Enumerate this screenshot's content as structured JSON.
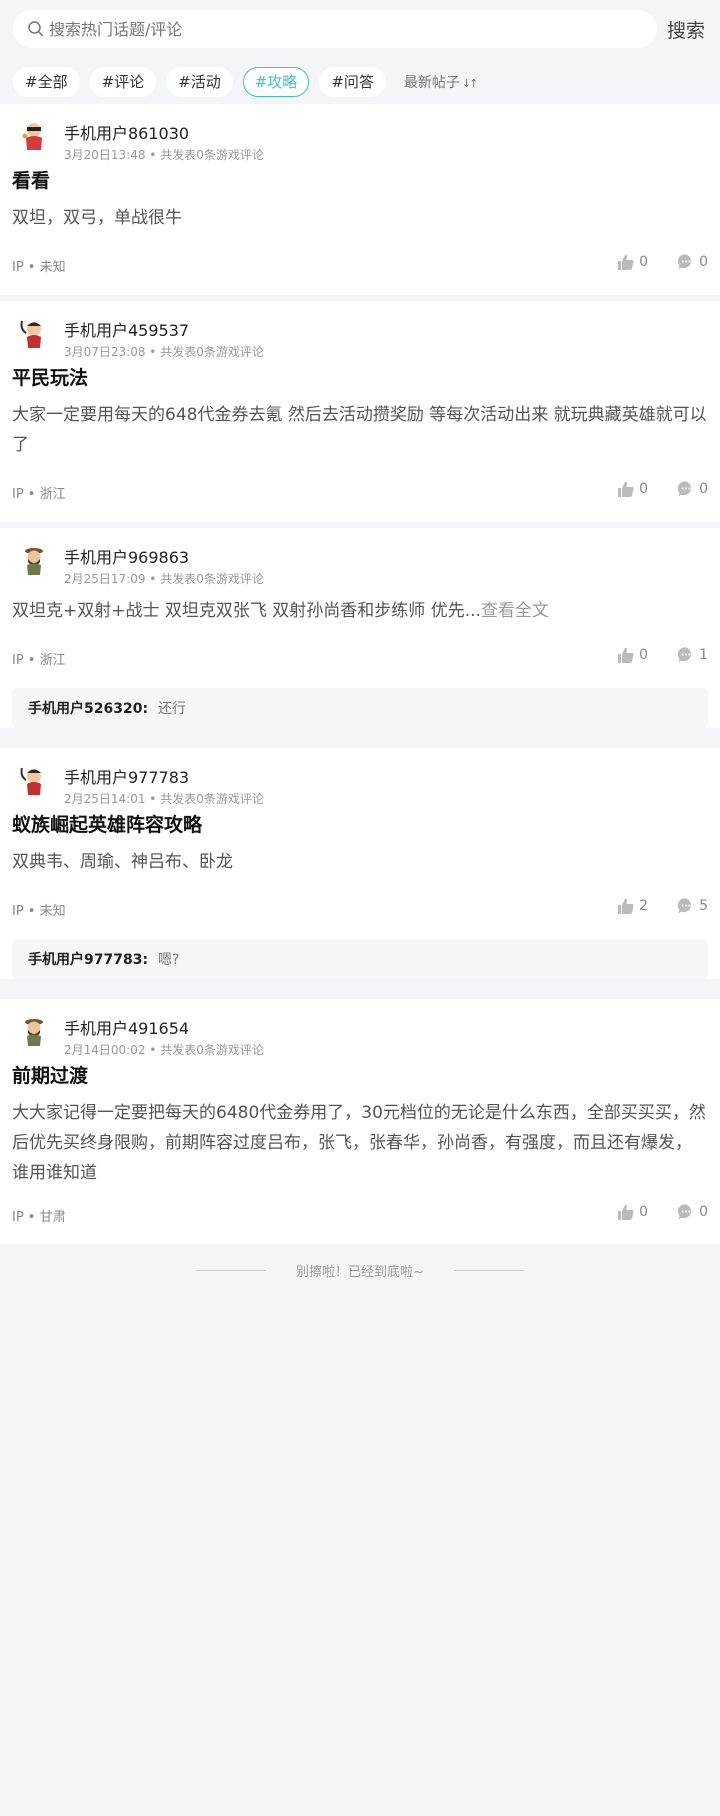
{
  "search": {
    "placeholder": "搜索热门话题/评论",
    "button": "搜索"
  },
  "tags": [
    "#全部",
    "#评论",
    "#活动",
    "#攻略",
    "#问答"
  ],
  "active_tag": "#攻略",
  "sort": {
    "label": "最新帖子",
    "icon": "sort-arrows-icon"
  },
  "posts": [
    {
      "user": "手机用户861030",
      "meta": "3月20日13:48 • 共发表0条游戏评论",
      "title": "看看",
      "content": "双坦，双弓，单战很牛",
      "ip": "IP • 未知",
      "likes": "0",
      "comments": "0"
    },
    {
      "user": "手机用户459537",
      "meta": "3月07日23:08 • 共发表0条游戏评论",
      "title": "平民玩法",
      "content": "大家一定要用每天的648代金券去氪 然后去活动攒奖励 等每次活动出来 就玩典藏英雄就可以了",
      "ip": "IP • 浙江",
      "likes": "0",
      "comments": "0"
    },
    {
      "user": "手机用户969863",
      "meta": "2月25日17:09 • 共发表0条游戏评论",
      "content": "双坦克+双射+战士 双坦克双张飞 双射孙尚香和步练师 优先...",
      "read_more": "查看全文",
      "ip": "IP • 浙江",
      "likes": "0",
      "comments": "1",
      "reply": {
        "user": "手机用户526320:",
        "text": "还行"
      }
    },
    {
      "user": "手机用户977783",
      "meta": "2月25日14:01 • 共发表0条游戏评论",
      "title": "蚁族崛起英雄阵容攻略",
      "content": "双典韦、周瑜、神吕布、卧龙",
      "ip": "IP • 未知",
      "likes": "2",
      "comments": "5",
      "reply": {
        "user": "手机用户977783:",
        "text": "嗯?"
      }
    },
    {
      "user": "手机用户491654",
      "meta": "2月14日00:02 • 共发表0条游戏评论",
      "title": "前期过渡",
      "content": "大大家记得一定要把每天的6480代金券用了，30元档位的无论是什么东西，全部买买买，然后优先买终身限购，前期阵容过度吕布，张飞，张春华，孙尚香，有强度，而且还有爆发，谁用谁知道",
      "ip": "IP • 甘肃",
      "likes": "0",
      "comments": "0"
    }
  ],
  "end_tip": "别擦啦！已经到底啦~",
  "colors": {
    "accent": "#3ec4c6",
    "background": "#f4f5f7"
  }
}
